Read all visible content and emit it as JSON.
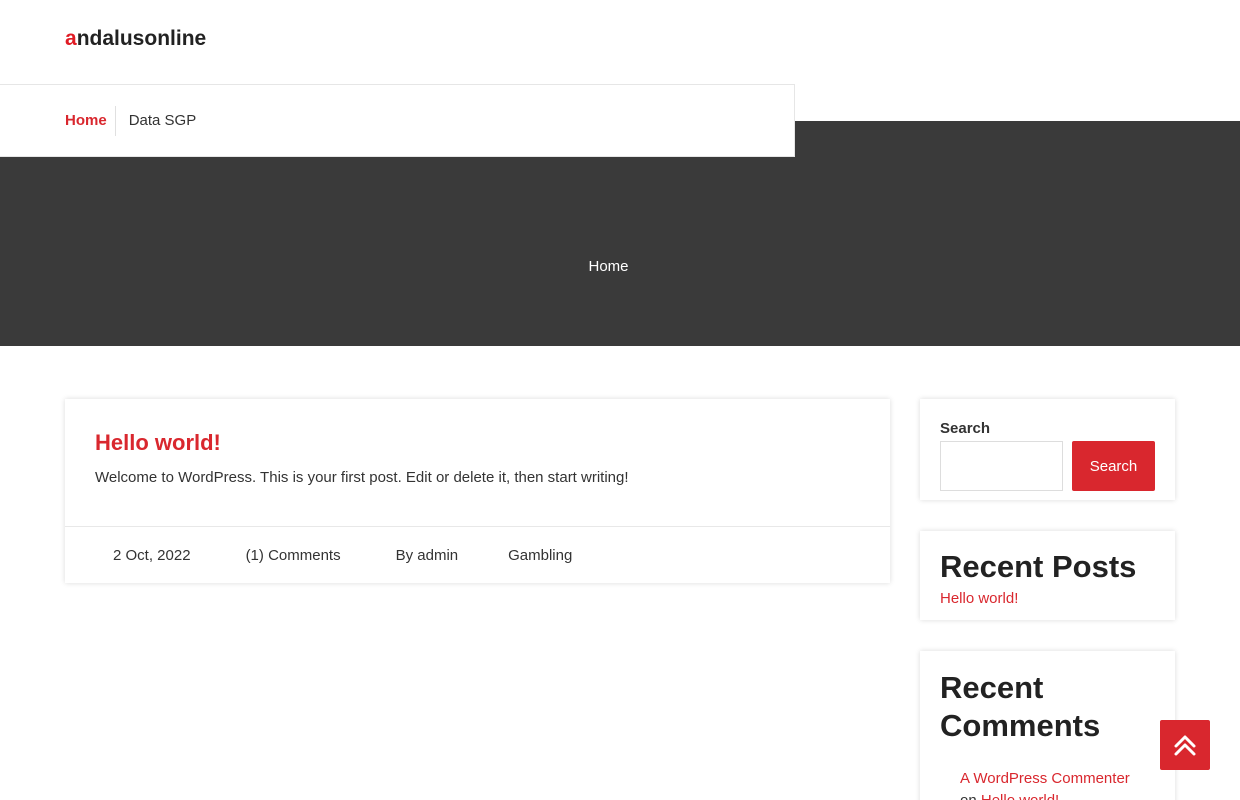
{
  "site": {
    "logo_first_letter": "a",
    "logo_rest": "ndalusonline"
  },
  "nav": {
    "items": [
      {
        "label": "Home"
      },
      {
        "label": "Data SGP"
      }
    ]
  },
  "breadcrumb": {
    "label": "Home"
  },
  "post": {
    "title": "Hello world!",
    "excerpt": "Welcome to WordPress. This is your first post. Edit or delete it, then start writing!",
    "date": "2 Oct, 2022",
    "comments": "(1) Comments",
    "author": "By admin",
    "category": "Gambling"
  },
  "sidebar": {
    "search": {
      "label": "Search",
      "placeholder": "",
      "button_label": "Search"
    },
    "recent_posts": {
      "heading": "Recent Posts",
      "items": [
        {
          "label": "Hello world!"
        }
      ]
    },
    "recent_comments": {
      "heading": "Recent Comments",
      "items": [
        {
          "author": "A WordPress Commenter",
          "on": "on",
          "post": "Hello world!"
        }
      ]
    }
  },
  "icons": {
    "to_top": "double-chevron-up-icon"
  },
  "colors": {
    "accent": "#d9272e",
    "band": "#3a3a3a"
  }
}
